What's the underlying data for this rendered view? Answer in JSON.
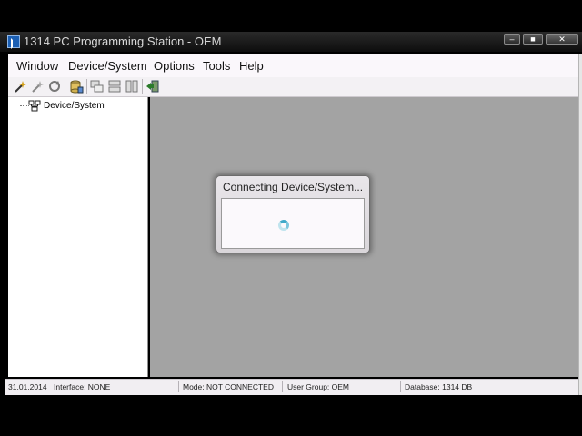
{
  "window": {
    "title": "1314 PC Programming Station - OEM",
    "app_icon": "app-k-icon",
    "controls": [
      "minimize-icon",
      "maximize-icon",
      "close-icon"
    ]
  },
  "menu": {
    "items": [
      "Window",
      "Device/System",
      "Options",
      "Tools",
      "Help"
    ]
  },
  "toolbar": {
    "icons": [
      "wand-icon",
      "wand-disabled-icon",
      "refresh-icon",
      "database-icon",
      "cascade-icon",
      "tile-horizontal-icon",
      "tile-vertical-icon",
      "exit-icon"
    ]
  },
  "tree": {
    "root_label": "Device/System",
    "root_icon": "network-device-icon"
  },
  "dialog": {
    "title": "Connecting Device/System...",
    "spinner_icon": "loading-spinner-icon"
  },
  "status": {
    "date": "31.01.2014",
    "interface": "Interface: NONE",
    "mode": "Mode: NOT CONNECTED",
    "user_group": "User Group: OEM",
    "database": "Database: 1314 DB"
  },
  "colors": {
    "workspace": "#a3a3a3",
    "menubar": "#faf7fb",
    "titlebar": "#111111"
  }
}
